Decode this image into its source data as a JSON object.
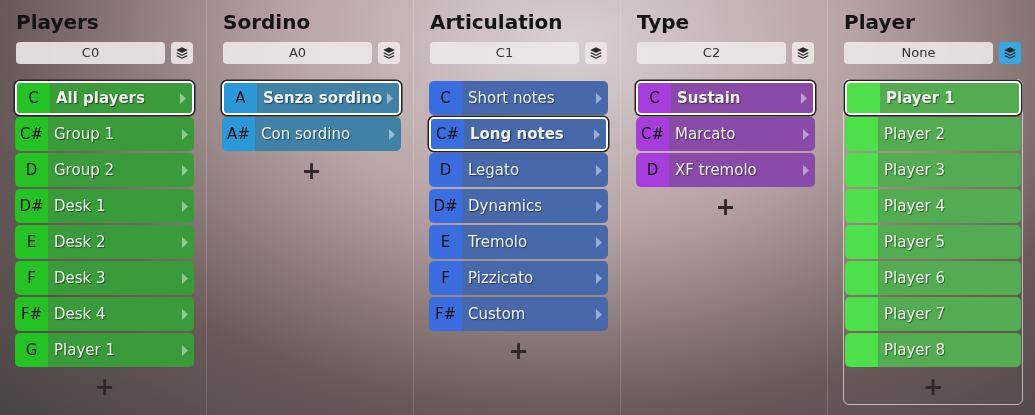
{
  "columns": [
    {
      "kind": "keyswitch",
      "title": "Players",
      "field": "C0",
      "layers_active": false,
      "color": "#22c322",
      "items": [
        {
          "key": "C",
          "label": "All players",
          "selected": true
        },
        {
          "key": "C#",
          "label": "Group 1",
          "selected": false
        },
        {
          "key": "D",
          "label": "Group 2",
          "selected": false
        },
        {
          "key": "D#",
          "label": "Desk 1",
          "selected": false
        },
        {
          "key": "E",
          "label": "Desk 2",
          "selected": false
        },
        {
          "key": "F",
          "label": "Desk 3",
          "selected": false
        },
        {
          "key": "F#",
          "label": "Desk 4",
          "selected": false
        },
        {
          "key": "G",
          "label": "Player 1",
          "selected": false
        }
      ],
      "add": "+"
    },
    {
      "kind": "keyswitch",
      "title": "Sordino",
      "field": "A0",
      "layers_active": false,
      "color": "#2a98d8",
      "items": [
        {
          "key": "A",
          "label": "Senza sordino",
          "selected": true
        },
        {
          "key": "A#",
          "label": "Con sordino",
          "selected": false
        }
      ],
      "add": "+"
    },
    {
      "kind": "keyswitch",
      "title": "Articulation",
      "field": "C1",
      "layers_active": false,
      "color": "#3a6ee0",
      "items": [
        {
          "key": "C",
          "label": "Short notes",
          "selected": false
        },
        {
          "key": "C#",
          "label": "Long notes",
          "selected": true
        },
        {
          "key": "D",
          "label": "Legato",
          "selected": false
        },
        {
          "key": "D#",
          "label": "Dynamics",
          "selected": false
        },
        {
          "key": "E",
          "label": "Tremolo",
          "selected": false
        },
        {
          "key": "F",
          "label": "Pizzicato",
          "selected": false
        },
        {
          "key": "F#",
          "label": "Custom",
          "selected": false
        }
      ],
      "add": "+"
    },
    {
      "kind": "keyswitch",
      "title": "Type",
      "field": "C2",
      "layers_active": false,
      "color": "#a63cdc",
      "items": [
        {
          "key": "C",
          "label": "Sustain",
          "selected": true
        },
        {
          "key": "C#",
          "label": "Marcato",
          "selected": false
        },
        {
          "key": "D",
          "label": "XF tremolo",
          "selected": false
        }
      ],
      "add": "+"
    },
    {
      "kind": "player",
      "title": "Player",
      "field": "None",
      "layers_active": true,
      "color": "#4ee04a",
      "items": [
        {
          "label": "Player 1",
          "selected": true
        },
        {
          "label": "Player 2",
          "selected": false
        },
        {
          "label": "Player 3",
          "selected": false
        },
        {
          "label": "Player 4",
          "selected": false
        },
        {
          "label": "Player 5",
          "selected": false
        },
        {
          "label": "Player 6",
          "selected": false
        },
        {
          "label": "Player 7",
          "selected": false
        },
        {
          "label": "Player 8",
          "selected": false
        }
      ],
      "add": "+"
    }
  ]
}
